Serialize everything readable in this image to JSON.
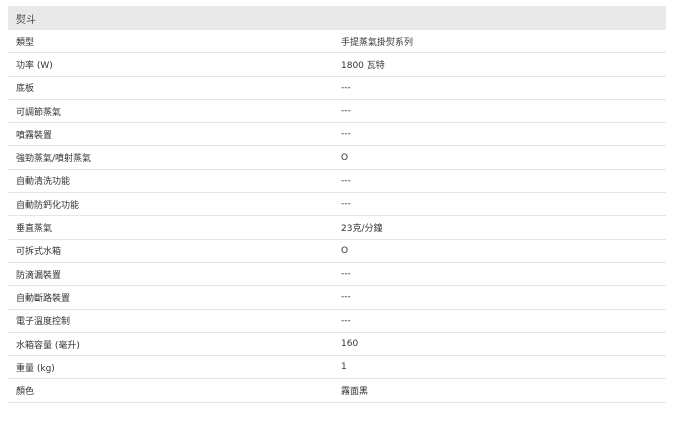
{
  "section_title": "熨斗",
  "rows": [
    {
      "label": "類型",
      "value": "手提蒸氣掛熨系列"
    },
    {
      "label": "功率 (W)",
      "value": "1800 瓦特"
    },
    {
      "label": "底板",
      "value": "---"
    },
    {
      "label": "可調節蒸氣",
      "value": "---"
    },
    {
      "label": "噴霧裝置",
      "value": "---"
    },
    {
      "label": "強勁蒸氣/噴射蒸氣",
      "value": "O"
    },
    {
      "label": "自動清洗功能",
      "value": "---"
    },
    {
      "label": "自動防鈣化功能",
      "value": "---"
    },
    {
      "label": "垂直蒸氣",
      "value": "23克/分鐘"
    },
    {
      "label": "可拆式水箱",
      "value": "O"
    },
    {
      "label": "防滴漏裝置",
      "value": "---"
    },
    {
      "label": "自動斷路裝置",
      "value": "---"
    },
    {
      "label": "電子溫度控制",
      "value": "---"
    },
    {
      "label": "水箱容量 (毫升)",
      "value": "160"
    },
    {
      "label": "重量 (kg)",
      "value": "1"
    },
    {
      "label": "顏色",
      "value": "霧面黑"
    }
  ]
}
